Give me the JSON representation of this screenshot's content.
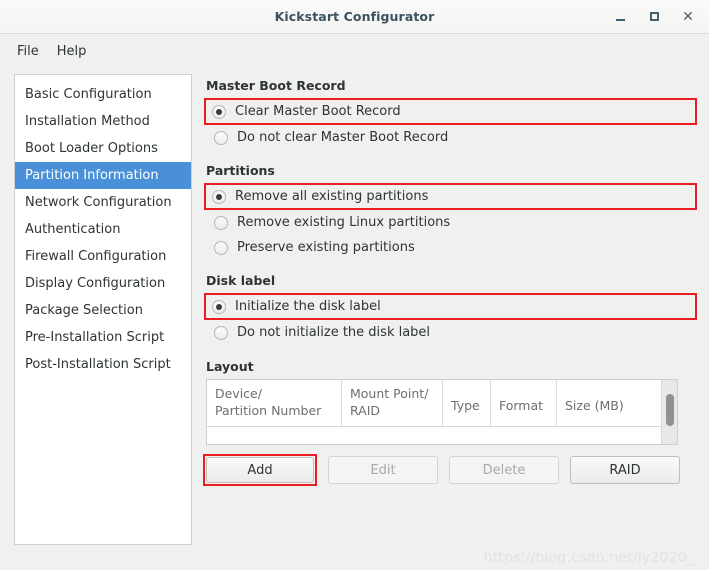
{
  "window": {
    "title": "Kickstart Configurator",
    "controls": {
      "minimize": "minimize",
      "maximize": "maximize",
      "close": "close"
    }
  },
  "menubar": {
    "items": [
      {
        "label": "File"
      },
      {
        "label": "Help"
      }
    ]
  },
  "sidebar": {
    "items": [
      {
        "label": "Basic Configuration",
        "selected": false
      },
      {
        "label": "Installation Method",
        "selected": false
      },
      {
        "label": "Boot Loader Options",
        "selected": false
      },
      {
        "label": "Partition Information",
        "selected": true
      },
      {
        "label": "Network Configuration",
        "selected": false
      },
      {
        "label": "Authentication",
        "selected": false
      },
      {
        "label": "Firewall Configuration",
        "selected": false
      },
      {
        "label": "Display Configuration",
        "selected": false
      },
      {
        "label": "Package Selection",
        "selected": false
      },
      {
        "label": "Pre-Installation Script",
        "selected": false
      },
      {
        "label": "Post-Installation Script",
        "selected": false
      }
    ]
  },
  "main": {
    "master_boot_record": {
      "title": "Master Boot Record",
      "options": [
        {
          "label": "Clear Master Boot Record",
          "checked": true,
          "highlighted": true
        },
        {
          "label": "Do not clear Master Boot Record",
          "checked": false,
          "highlighted": false
        }
      ]
    },
    "partitions": {
      "title": "Partitions",
      "options": [
        {
          "label": "Remove all existing partitions",
          "checked": true,
          "highlighted": true
        },
        {
          "label": "Remove existing Linux partitions",
          "checked": false,
          "highlighted": false
        },
        {
          "label": "Preserve existing partitions",
          "checked": false,
          "highlighted": false
        }
      ]
    },
    "disk_label": {
      "title": "Disk label",
      "options": [
        {
          "label": "Initialize the disk label",
          "checked": true,
          "highlighted": true
        },
        {
          "label": "Do not initialize the disk label",
          "checked": false,
          "highlighted": false
        }
      ]
    },
    "layout": {
      "title": "Layout",
      "table": {
        "columns": [
          "Device/\nPartition Number",
          "Mount Point/\nRAID",
          "Type",
          "Format",
          "Size (MB)"
        ],
        "rows": []
      },
      "buttons": [
        {
          "label": "Add",
          "enabled": true,
          "highlighted": true
        },
        {
          "label": "Edit",
          "enabled": false,
          "highlighted": false
        },
        {
          "label": "Delete",
          "enabled": false,
          "highlighted": false
        },
        {
          "label": "RAID",
          "enabled": true,
          "highlighted": false
        }
      ]
    }
  },
  "watermark": {
    "text": "https://blog.csdn.net/ly2020_"
  },
  "colors": {
    "selection_blue": "#4a90d9",
    "annotation_red": "#ec1c24",
    "window_bg": "#f0f0ef",
    "title_text": "#3c5260"
  }
}
